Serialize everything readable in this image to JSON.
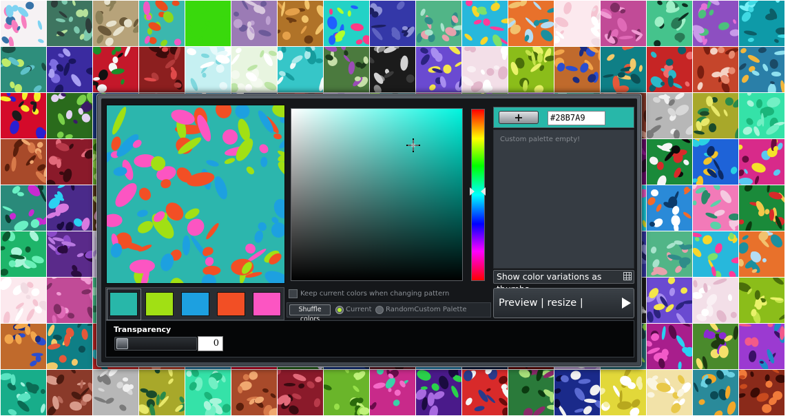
{
  "editor": {
    "hex_value": "#28B7A9",
    "add_button_label": "+",
    "palette_empty_text": "Custom palette empty!",
    "show_thumbs_label": "Show color variations as thumbs",
    "keep_colors_label": "Keep current colors when changing pattern",
    "shuffle_label": "Shuffle colors",
    "radio_current_label": "Current",
    "radio_random_label": "RandomCustom Palette",
    "preview_label": "Preview | resize | download",
    "transparency_label": "Transparency",
    "transparency_value": "0",
    "base_hue": "#00f5df"
  },
  "pattern_colors": [
    "#28b7a9",
    "#a1e014",
    "#1da0e0",
    "#f24f25",
    "#fc55c2"
  ],
  "thumbnail_palettes": [
    [
      "#f6f2f4",
      "#f77ebf",
      "#7fd3f2",
      "#3773a8"
    ],
    [
      "#3e7560",
      "#b5e19a",
      "#7dc9ae",
      "#2d3d3a"
    ],
    [
      "#b7a37a",
      "#e7e2cd",
      "#8c8058",
      "#6b5a3a"
    ],
    [
      "#3bb7ae",
      "#e94d1e",
      "#8dd81c",
      "#f059c4"
    ],
    [
      "#39d90c",
      "#39d90c",
      "#39d90c",
      "#39d90c"
    ],
    [
      "#9b7bb5",
      "#d9c8df",
      "#6c5a99",
      "#bfa2d2"
    ],
    [
      "#b07328",
      "#f2c46b",
      "#6e3d12",
      "#e5a14a"
    ],
    [
      "#23d2c6",
      "#ff3a85",
      "#1f61ff",
      "#b1ff2c"
    ],
    [
      "#3438a8",
      "#8c90d6",
      "#1c1f63",
      "#5e63c2"
    ],
    [
      "#51b587",
      "#e8a1ac",
      "#2f8c89",
      "#a8e3cc"
    ],
    [
      "#27b8dc",
      "#f7d62c",
      "#ff3b9a",
      "#7de16a"
    ],
    [
      "#e8712b",
      "#b5dcf2",
      "#1c8f9e",
      "#f2c26e"
    ],
    [
      "#fce9ee",
      "#f5c5d2",
      "#ffffff",
      "#f1dbe2"
    ],
    [
      "#c14b97",
      "#f09ad3",
      "#7f2c63",
      "#e06ab7"
    ],
    [
      "#45c38c",
      "#0e3022",
      "#9ff0c7",
      "#297a56"
    ],
    [
      "#8d4fc1",
      "#e46fd6",
      "#4cc07c",
      "#c99ae9"
    ],
    [
      "#0e9aa8",
      "#3fd9e3",
      "#0c5e67",
      "#76f0f7"
    ],
    [
      "#2e8e7c",
      "#c0eb6a",
      "#5ec2c9",
      "#1a4d44"
    ],
    [
      "#3a2ba0",
      "#7e6ee0",
      "#1a1560",
      "#a99ff2"
    ],
    [
      "#c4182a",
      "#1a8f2a",
      "#f5f5f5",
      "#111111"
    ],
    [
      "#8c1f1f",
      "#e04a4a",
      "#3c0b0b",
      "#b23a3a"
    ],
    [
      "#c6f0f2",
      "#ffffff",
      "#7fd8de",
      "#e7fafb"
    ],
    [
      "#e8f5e0",
      "#ffffff",
      "#bde5a6",
      "#f4faef"
    ],
    [
      "#36c6c8",
      "#f0faf9",
      "#159b9d",
      "#a8e9ea"
    ],
    [
      "#4b7a3e",
      "#c6e0a8",
      "#9b4db6",
      "#1e3a1c"
    ],
    [
      "#1b1b1b",
      "#8a8a8a",
      "#d2d2d2",
      "#3a3a3a"
    ],
    [
      "#6a4ad1",
      "#f4e64b",
      "#2c2380",
      "#a88ef0"
    ],
    [
      "#f3dfe8",
      "#ffffff",
      "#e3b8cc",
      "#faf0f4"
    ],
    [
      "#8bbd1a",
      "#e9f26a",
      "#4a6e0a",
      "#c5e44a"
    ],
    [
      "#c06a2c",
      "#2a4ed1",
      "#f2a64c",
      "#1b2c80"
    ],
    [
      "#0f7f86",
      "#e5593a",
      "#f2c96a",
      "#0b4f55"
    ],
    [
      "#c62525",
      "#2bb8c8",
      "#0e5f6a",
      "#f06c6c"
    ],
    [
      "#c5452b",
      "#f4d2c4",
      "#7a1e10",
      "#e88a70"
    ],
    [
      "#2a7fa8",
      "#f2b63c",
      "#8ee0ef",
      "#1a4a66"
    ],
    [
      "#d40a2a",
      "#2a1fd1",
      "#f5ef2a",
      "#1b1b1b"
    ],
    [
      "#2a6b1c",
      "#e2d2f2",
      "#7ad14a",
      "#3a1a66"
    ],
    [
      "#1a3a8a",
      "#c93ac8",
      "#58d13a",
      "#0b1b40"
    ],
    [
      "#6c1c2a",
      "#f2a8b0",
      "#1e8a4a",
      "#3a0b12"
    ],
    [
      "#2e8bb8",
      "#b7e3f2",
      "#1d4a6e",
      "#f0f8fb"
    ],
    [
      "#0d1b40",
      "#c4e7f5",
      "#3c6ea8",
      "#ffffff"
    ],
    [
      "#6c0b0b",
      "#f0f0f0",
      "#a81e1e",
      "#2a0505"
    ],
    [
      "#c7a9e0",
      "#ffffff",
      "#9a78c6",
      "#e9dcf4"
    ],
    [
      "#2a6f7a",
      "#98e04a",
      "#1b3b40",
      "#bff07a"
    ],
    [
      "#a81e8c",
      "#f25ac8",
      "#2ad1f2",
      "#5a0b4a"
    ],
    [
      "#4a8a2c",
      "#f5e06a",
      "#8a2ad1",
      "#1e3a10"
    ],
    [
      "#9b3ad1",
      "#1e8ac8",
      "#f25a8a",
      "#3a1066"
    ],
    [
      "#18ad8a",
      "#5ae4c2",
      "#0b6b54",
      "#9ef2dd"
    ],
    [
      "#8a3a2a",
      "#d89a8a",
      "#4a1a10",
      "#b86a5a"
    ],
    [
      "#b7b7b7",
      "#f0f0f0",
      "#7a7a7a",
      "#d8d8d8"
    ],
    [
      "#a8a82a",
      "#2a8a4a",
      "#e8e86a",
      "#1a4a2a"
    ],
    [
      "#35e2a8",
      "#a8f5da",
      "#1ab57a",
      "#72f0c4"
    ],
    [
      "#a84a2a",
      "#f0a870",
      "#5a1e0b",
      "#d87a4a"
    ],
    [
      "#8a1a2a",
      "#e26a7a",
      "#3a0a10",
      "#b83a4a"
    ],
    [
      "#6ab52a",
      "#c0f27a",
      "#2a6a0b",
      "#98e04a"
    ],
    [
      "#c82a8a",
      "#3ad1a8",
      "#f56ac8",
      "#6a0b4a"
    ],
    [
      "#4a1a8a",
      "#a86ae0",
      "#2ad14a",
      "#1a0b40"
    ],
    [
      "#d82a2a",
      "#2a3a8a",
      "#f5f5f5",
      "#6a0b0b"
    ],
    [
      "#2a7a3a",
      "#a8e07a",
      "#8a2a6a",
      "#0b3a10"
    ],
    [
      "#1a2a8a",
      "#f0f0f0",
      "#5a6ad1",
      "#0b0b40"
    ],
    [
      "#e2d83a",
      "#ffffff",
      "#b8a81e",
      "#f5f0a8"
    ],
    [
      "#f2e2a8",
      "#ffffff",
      "#e8c84a",
      "#faf5e0"
    ],
    [
      "#2a8a9a",
      "#f2a82a",
      "#0b4a55",
      "#6ad1e2"
    ],
    [
      "#8a2a1a",
      "#f07a3a",
      "#3a0b05",
      "#c84a1e"
    ],
    [
      "#5a1a6a",
      "#b84ac8",
      "#2a0b30",
      "#8a2a9a"
    ],
    [
      "#6a0b6a",
      "#c82ac8",
      "#2a0b2a",
      "#9a1a9a"
    ],
    [
      "#1a8a3a",
      "#f5f5f5",
      "#d82a2a",
      "#0b0b0b"
    ],
    [
      "#1e63d8",
      "#f2c42a",
      "#2ad1e2",
      "#0b2a66"
    ],
    [
      "#d82a8a",
      "#5ac8f2",
      "#f5e22a",
      "#6a0b40"
    ],
    [
      "#2a8a7a",
      "#c82ad1",
      "#6af0c4",
      "#0b3a30"
    ],
    [
      "#4a2a8a",
      "#d87ae0",
      "#2ad1f2",
      "#1a0b40"
    ],
    [
      "#5a3a1a",
      "#f0a8c8",
      "#c8e07a",
      "#2a1a0b"
    ],
    [
      "#f5d0e0",
      "#ffffff",
      "#e890b8",
      "#faeaf1"
    ],
    [
      "#c4a07a",
      "#f5e8d8",
      "#8a6a4a",
      "#e0c8a8"
    ],
    [
      "#c8a88a",
      "#f5ebe0",
      "#8a6a4a",
      "#e8d2b8"
    ],
    [
      "#c81e8c",
      "#f25ac8",
      "#6a0b4a",
      "#e88ad1"
    ],
    [
      "#c81e6a",
      "#f24a98",
      "#6a0b35",
      "#e87ab8"
    ],
    [
      "#4a1a4a",
      "#c8a8c8",
      "#1a0b1a",
      "#8a5a8a"
    ],
    [
      "#a8583a",
      "#e8c8b8",
      "#5a2a1a",
      "#d89a7a"
    ],
    [
      "#f05a0b",
      "#ffb88a",
      "#ffffff",
      "#c83a05"
    ],
    [
      "#b86a4a",
      "#f5d8c8",
      "#6a3a1a",
      "#e8a88a"
    ],
    [
      "#0b0b0b",
      "#a8e22a",
      "#c82ac8",
      "#2ad1f2"
    ],
    [
      "#1ad1e2",
      "#e2e22a",
      "#0b0b0b",
      "#f25ac8"
    ],
    [
      "#2a8ad8",
      "#f26a2a",
      "#ffffff",
      "#0b3a6a"
    ],
    [
      "#f27ab8",
      "#5ad1a8",
      "#f5c8e0",
      "#2a8a6a"
    ],
    [
      "#1a8a3a",
      "#f2c84a",
      "#d82a2a",
      "#0b3a10"
    ],
    [
      "#1eb56a",
      "#6af0b8",
      "#0b5a30",
      "#a8f5d8"
    ],
    [
      "#5a2a8a",
      "#b878e0",
      "#2a0b40",
      "#8a4ac8"
    ],
    [
      "#e0d2f2",
      "#ffffff",
      "#b898e0",
      "#f0e8f8"
    ],
    [
      "#0d6ad8",
      "#f2f2f2",
      "#5ab8f2",
      "#0b2a66"
    ],
    [
      "#1e1e1e",
      "#4a4a4a",
      "#2a1a1a",
      "#6a6a6a"
    ]
  ]
}
